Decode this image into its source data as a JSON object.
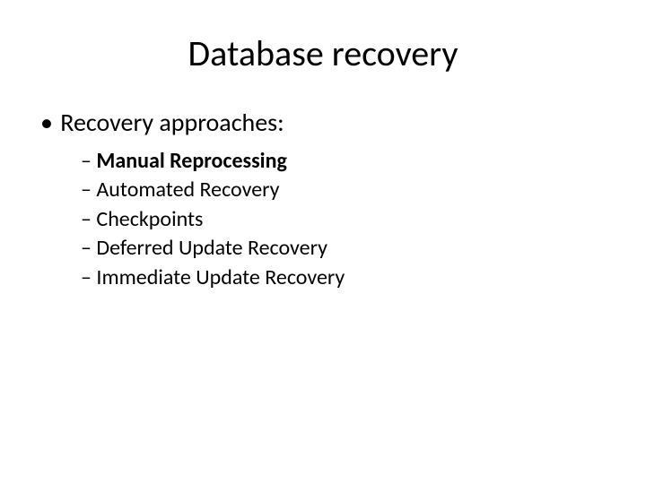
{
  "title": "Database recovery",
  "bullet1": "Recovery approaches:",
  "sub1": "Manual Reprocessing",
  "sub2": "Automated Recovery",
  "sub3": "Checkpoints",
  "sub4": "Deferred Update Recovery",
  "sub5": "Immediate Update Recovery"
}
